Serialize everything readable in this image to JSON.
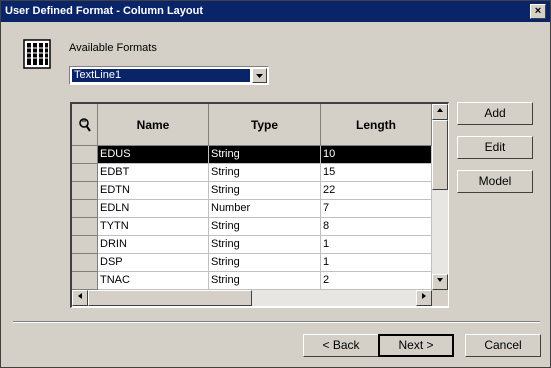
{
  "window": {
    "title": "User Defined Format - Column Layout",
    "close_glyph": "×"
  },
  "formats": {
    "label": "Available Formats",
    "selected": "TextLine1"
  },
  "grid": {
    "columns": [
      "Name",
      "Type",
      "Length"
    ],
    "rows": [
      {
        "name": "EDUS",
        "type": "String",
        "length": "10"
      },
      {
        "name": "EDBT",
        "type": "String",
        "length": "15"
      },
      {
        "name": "EDTN",
        "type": "String",
        "length": "22"
      },
      {
        "name": "EDLN",
        "type": "Number",
        "length": "7"
      },
      {
        "name": "TYTN",
        "type": "String",
        "length": "8"
      },
      {
        "name": "DRIN",
        "type": "String",
        "length": "1"
      },
      {
        "name": "DSP",
        "type": "String",
        "length": "1"
      },
      {
        "name": "TNAC",
        "type": "String",
        "length": "2"
      }
    ],
    "selected_row": "EDUS"
  },
  "side_buttons": {
    "add": "Add",
    "edit": "Edit",
    "model": "Model"
  },
  "footer_buttons": {
    "back": "< Back",
    "next": "Next >",
    "cancel": "Cancel"
  },
  "colors": {
    "titlebar": "#0a246a",
    "face": "#d4d0c8",
    "selection": "#000000"
  }
}
